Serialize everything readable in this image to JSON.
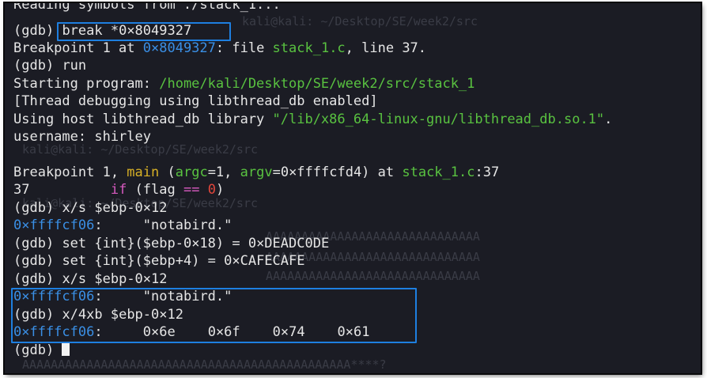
{
  "terminal": {
    "line_reading": "Reading symbols from ./stack_1...",
    "gdb_prompt": "(gdb)",
    "cmd_break": "break *0×8049327",
    "bp_set_prefix": "Breakpoint 1 at ",
    "bp_set_addr": "0×8049327",
    "bp_set_mid": ": file ",
    "bp_set_file": "stack_1.c",
    "bp_set_suffix": ", line 37.",
    "cmd_run": "run",
    "starting_prefix": "Starting program: ",
    "starting_path": "/home/kali/Desktop/SE/week2/src/stack_1",
    "thread_debug": "[Thread debugging using libthread_db enabled]",
    "using_host_prefix": "Using host libthread_db library ",
    "using_host_path": "\"/lib/x86_64-linux-gnu/libthread_db.so.1\"",
    "using_host_suffix": ".",
    "username_line": "username: shirley",
    "bp_hit_prefix": "Breakpoint 1, ",
    "bp_hit_func": "main",
    "bp_hit_open": " (",
    "bp_hit_argc_name": "argc",
    "bp_hit_argc_val": "=1, ",
    "bp_hit_argv_name": "argv",
    "bp_hit_argv_val": "=0×ffffcfd4) at ",
    "bp_hit_file": "stack_1.c",
    "bp_hit_line": ":37",
    "src_line_no": "37",
    "src_if": "if",
    "src_paren_open": " (flag ",
    "src_eq": "==",
    "src_zero": "0",
    "src_paren_close": ")",
    "cmd_xs_1": "x/s $ebp-0×12",
    "addr": "0×ffffcf06",
    "addr_colon": ":",
    "str_value": "\"notabird.\"",
    "cmd_set_1": "set {int}($ebp-0×18) = 0×DEADC0DE",
    "cmd_set_2": "set {int}($ebp+4) = 0×CAFECAFE",
    "cmd_xs_2": "x/s $ebp-0×12",
    "cmd_x4xb": "x/4xb $ebp-0×12",
    "bytes": [
      "0×6e",
      "0×6f",
      "0×74",
      "0×61"
    ]
  },
  "colors": {
    "background": "#1b1c24",
    "text": "#e6e6e6",
    "address_blue": "#3a8fe5",
    "path_green": "#59c240",
    "func_yellow": "#d7b026",
    "keyword_pink": "#d85ac0",
    "number_red": "#e2463b",
    "highlight_box": "#1e7fe0"
  }
}
